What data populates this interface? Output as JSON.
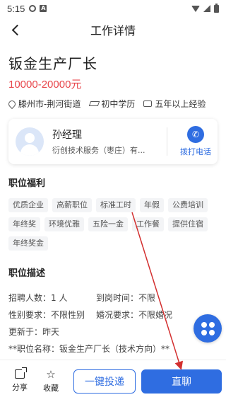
{
  "status_bar": {
    "time": "5:15"
  },
  "nav": {
    "title": "工作详情"
  },
  "job": {
    "title": "钣金生产厂长",
    "salary": "10000-20000元",
    "location": "滕州市-荆河街道",
    "education": "初中学历",
    "experience": "五年以上经验"
  },
  "contact": {
    "name": "孙经理",
    "company": "衍创技术服务（枣庄）有...",
    "call_label": "拨打电话"
  },
  "benefits": {
    "title": "职位福利",
    "tags": [
      "优质企业",
      "高薪职位",
      "标准工时",
      "年假",
      "公费培训",
      "年终奖",
      "环境优雅",
      "五险一金",
      "工作餐",
      "提供住宿",
      "年终奖金"
    ]
  },
  "description": {
    "title": "职位描述",
    "recruit": "招聘人数：1 人",
    "arrival": "到岗时间：不限",
    "gender": "性别要求：不限性别",
    "marriage": "婚况要求：不限婚况",
    "updated": "更新于：昨天",
    "position_name": "**职位名称：钣金生产厂长（技术方向）**"
  },
  "bottom_bar": {
    "share": "分享",
    "favorite": "收藏",
    "apply": "一键投递",
    "chat": "直聊"
  },
  "colors": {
    "accent": "#2f6de1",
    "salary": "#e8464b",
    "annotation": "#d32f2f"
  }
}
